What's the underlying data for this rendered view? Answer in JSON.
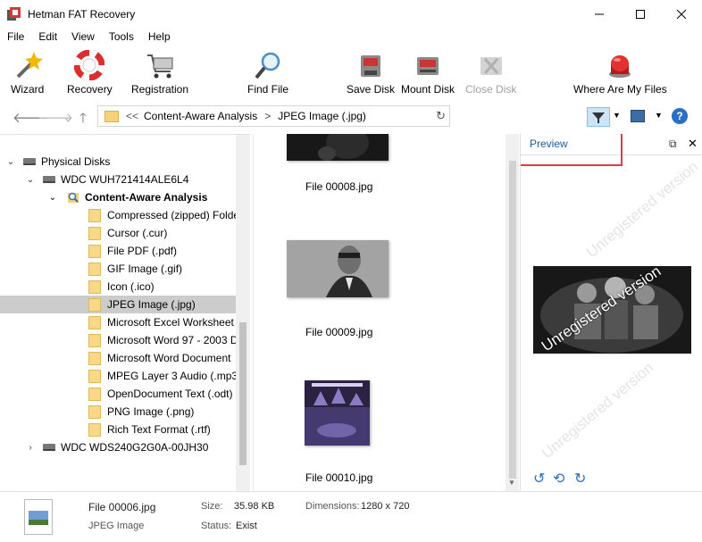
{
  "window": {
    "title": "Hetman FAT Recovery"
  },
  "menu": {
    "items": [
      "File",
      "Edit",
      "View",
      "Tools",
      "Help"
    ]
  },
  "toolbar": {
    "wizard": "Wizard",
    "recovery": "Recovery",
    "registration": "Registration",
    "find_file": "Find File",
    "save_disk": "Save Disk",
    "mount_disk": "Mount Disk",
    "close_disk": "Close Disk",
    "where_are_my_files": "Where Are My Files"
  },
  "address": {
    "overflow": "<<",
    "crumbs": [
      "Content-Aware Analysis",
      "JPEG Image (.jpg)"
    ],
    "separator": ">"
  },
  "tree": {
    "root": "Physical Disks",
    "disk1": "WDC  WUH721414ALE6L4",
    "analysis": "Content-Aware Analysis",
    "folders": [
      "Compressed (zipped) Folde",
      "Cursor (.cur)",
      "File PDF (.pdf)",
      "GIF Image (.gif)",
      "Icon (.ico)",
      "JPEG Image (.jpg)",
      "Microsoft Excel Worksheet",
      "Microsoft Word 97 - 2003 D",
      "Microsoft Word Document",
      "MPEG Layer 3 Audio (.mp3)",
      "OpenDocument Text (.odt)",
      "PNG Image (.png)",
      "Rich Text Format (.rtf)"
    ],
    "disk2": "WDC WDS240G2G0A-00JH30"
  },
  "files": [
    "File 00008.jpg",
    "File 00009.jpg",
    "File 00010.jpg"
  ],
  "preview": {
    "title": "Preview",
    "watermark": "Unregistered version"
  },
  "status": {
    "filename": "File 00006.jpg",
    "type": "JPEG Image",
    "size_label": "Size:",
    "size_value": "35.98 KB",
    "status_label": "Status:",
    "status_value": "Exist",
    "dimensions_label": "Dimensions:",
    "dimensions_value": "1280 x 720"
  },
  "colors": {
    "highlight_box": "#e03a4a",
    "link_blue": "#1e5a9e",
    "selection": "#cccccc"
  }
}
